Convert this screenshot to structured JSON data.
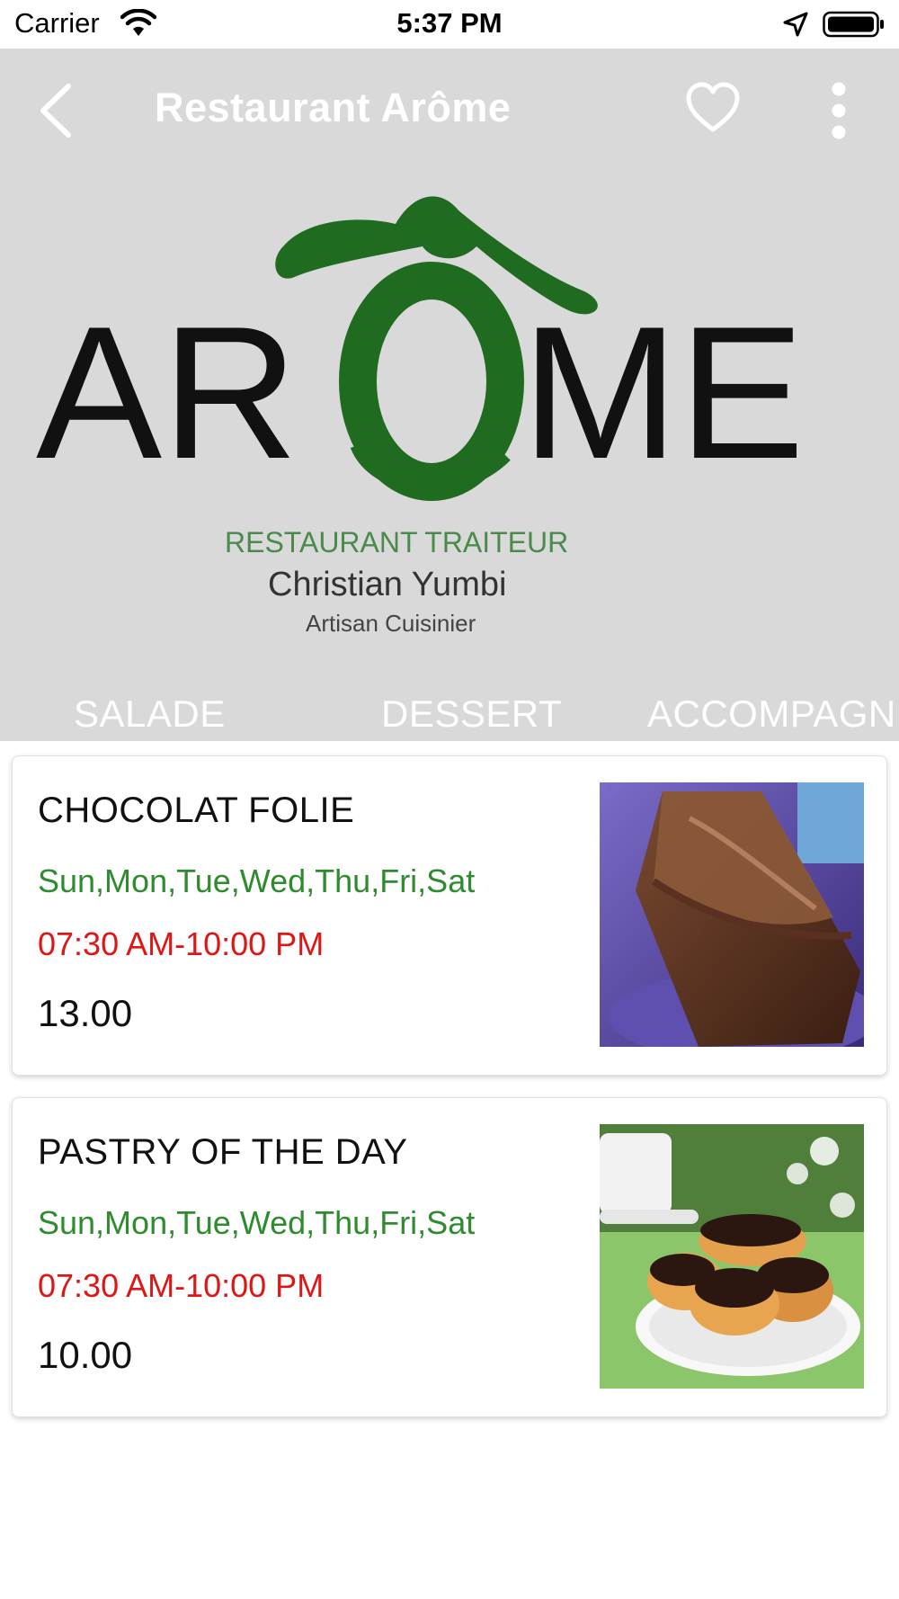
{
  "status_bar": {
    "carrier": "Carrier",
    "time": "5:37 PM"
  },
  "header": {
    "title": "Restaurant Arôme",
    "background_color": "#d9d9d9"
  },
  "logo": {
    "main_text_left": "AR",
    "main_text_right": "ME",
    "subtitle": "RESTAURANT   TRAITEUR",
    "chef": "Christian Yumbi",
    "role": "Artisan Cuisinier",
    "green": "#1f6b1f"
  },
  "tabs": [
    {
      "label": "SALADE"
    },
    {
      "label": "DESSERT"
    },
    {
      "label": "ACCOMPAGN..."
    }
  ],
  "selected_tab": "DESSERT",
  "items": [
    {
      "name": "CHOCOLAT FOLIE",
      "days": "Sun,Mon,Tue,Wed,Thu,Fri,Sat",
      "hours": "07:30 AM-10:00 PM",
      "price": "13.00",
      "image": "chocolate-cake-slice"
    },
    {
      "name": "PASTRY OF THE DAY",
      "days": "Sun,Mon,Tue,Wed,Thu,Fri,Sat",
      "hours": "07:30 AM-10:00 PM",
      "price": "10.00",
      "image": "eclairs-plate"
    }
  ],
  "colors": {
    "days": "#2e8b2e",
    "hours": "#e01515"
  }
}
